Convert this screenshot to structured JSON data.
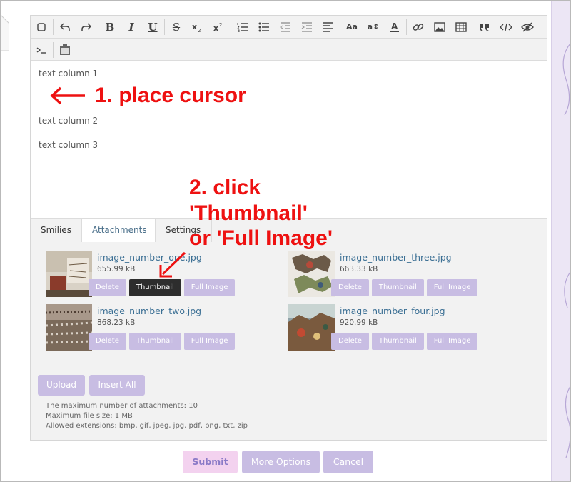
{
  "content": {
    "line1": "text column 1",
    "line2": "text column 2",
    "line3": "text column 3"
  },
  "tabs": [
    {
      "label": "Smilies"
    },
    {
      "label": "Attachments",
      "active": true
    },
    {
      "label": "Settings"
    }
  ],
  "toolbar": {
    "bold": "B",
    "italic": "I",
    "underline": "U",
    "strike": "S",
    "font_size": "Aa",
    "line_height": "a↕"
  },
  "attachments": [
    {
      "name": "image_number_one.jpg",
      "size": "655.99 kB"
    },
    {
      "name": "image_number_two.jpg",
      "size": "868.23 kB"
    },
    {
      "name": "image_number_three.jpg",
      "size": "663.33 kB"
    },
    {
      "name": "image_number_four.jpg",
      "size": "920.99 kB"
    }
  ],
  "attachment_buttons": {
    "delete": "Delete",
    "thumbnail": "Thumbnail",
    "full_image": "Full Image"
  },
  "panel": {
    "upload": "Upload",
    "insert_all": "Insert All",
    "notes": [
      "The maximum number of attachments: 10",
      "Maximum file size: 1 MB",
      "Allowed extensions: bmp, gif, jpeg, jpg, pdf, png, txt, zip"
    ]
  },
  "form_buttons": {
    "submit": "Submit",
    "more_options": "More Options",
    "cancel": "Cancel"
  },
  "annotations": {
    "step1": "1. place cursor",
    "step2_line1": "2. click",
    "step2_line2": "'Thumbnail'",
    "step2_line3": "or 'Full Image'"
  },
  "colors": {
    "accent_button": "#c8bde3",
    "submit_bg": "#f3d2ef",
    "annotation_red": "#ee1111",
    "link_blue": "#3b6f94"
  }
}
